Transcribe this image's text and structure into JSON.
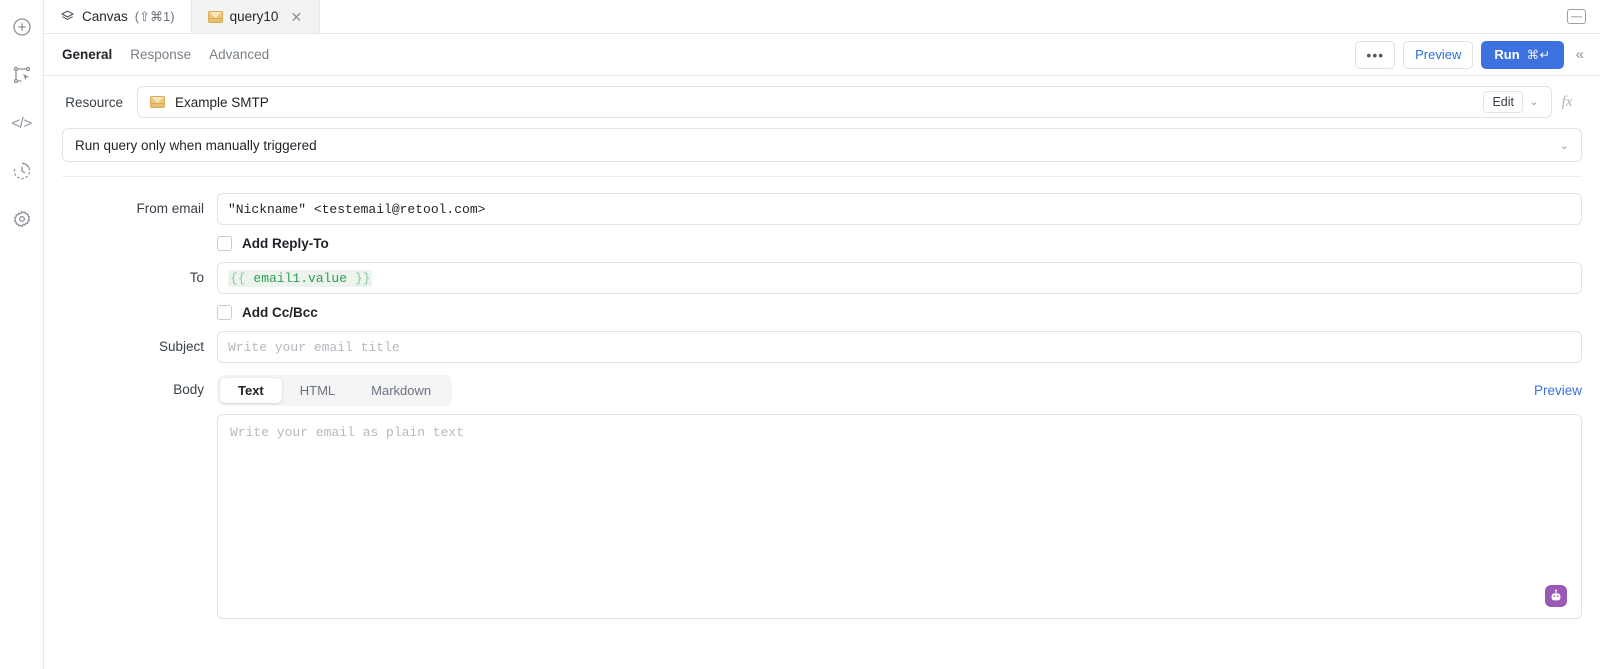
{
  "rail": {
    "items": [
      {
        "name": "add-icon",
        "title": "Add"
      },
      {
        "name": "select-frame-icon",
        "title": "Select"
      },
      {
        "name": "code-icon",
        "title": "Code",
        "glyph": "</>"
      },
      {
        "name": "history-icon",
        "title": "History"
      },
      {
        "name": "settings-gear-icon",
        "title": "Settings"
      }
    ]
  },
  "tabstrip": {
    "tabs": [
      {
        "label": "Canvas",
        "shortcut": "(⇧⌘1)",
        "icon": "layers-icon",
        "active": false,
        "closable": false
      },
      {
        "label": "query10",
        "shortcut": "",
        "icon": "email-envelope-icon",
        "active": true,
        "closable": true,
        "close_glyph": "✕"
      }
    ],
    "minimize_panel_title": "Collapse panel"
  },
  "toolbar": {
    "tabs": [
      {
        "label": "General",
        "active": true
      },
      {
        "label": "Response",
        "active": false
      },
      {
        "label": "Advanced",
        "active": false
      }
    ],
    "more_label": "•••",
    "preview_label": "Preview",
    "run_label": "Run",
    "run_shortcut": "⌘↵",
    "collapse_label": "«",
    "run_button_color": "#3c71df",
    "link_color": "#3c71df"
  },
  "resource": {
    "label": "Resource",
    "name": "Example SMTP",
    "icon": "email-envelope-icon",
    "edit_label": "Edit",
    "caret_glyph": "⌄",
    "fx_label": "fx"
  },
  "trigger": {
    "value": "Run query only when manually triggered",
    "caret_glyph": "⌄"
  },
  "form": {
    "from_email": {
      "label": "From email",
      "value": "\"Nickname\" <testemail@retool.com>"
    },
    "add_reply_to": {
      "label": "Add Reply-To",
      "checked": false
    },
    "to": {
      "label": "To",
      "open_brace": "{{",
      "expression": " email1.value ",
      "close_brace": "}}",
      "brace_color": "#8cc79a",
      "expr_color": "#2e9e55",
      "chip_bg": "#edf4ee"
    },
    "add_cc_bcc": {
      "label": "Add Cc/Bcc",
      "checked": false
    },
    "subject": {
      "label": "Subject",
      "value": "",
      "placeholder": "Write your email title"
    },
    "body": {
      "label": "Body",
      "modes": [
        {
          "label": "Text",
          "active": true
        },
        {
          "label": "HTML",
          "active": false
        },
        {
          "label": "Markdown",
          "active": false
        }
      ],
      "preview_label": "Preview",
      "value": "",
      "placeholder": "Write your email as plain text"
    }
  },
  "ai_assistant": {
    "name": "ai-assistant-icon",
    "color": "#9b59b6"
  }
}
